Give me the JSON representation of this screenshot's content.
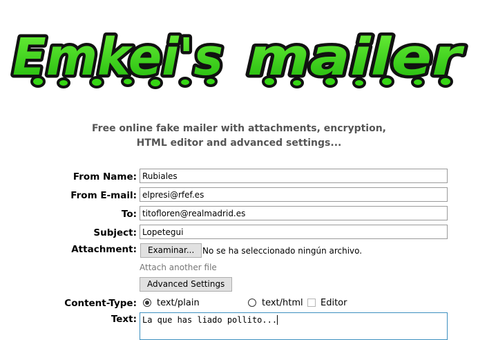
{
  "logo": {
    "word1": "Emkei's",
    "word2": "mailer"
  },
  "tagline": {
    "line1": "Free online fake mailer with attachments, encryption,",
    "line2": "HTML editor and advanced settings..."
  },
  "form": {
    "from_name": {
      "label": "From Name:",
      "value": "Rubiales"
    },
    "from_email": {
      "label": "From E-mail:",
      "value": "elpresi@rfef.es"
    },
    "to": {
      "label": "To:",
      "value": "titofloren@realmadrid.es"
    },
    "subject": {
      "label": "Subject:",
      "value": "Lopetegui"
    },
    "attachment": {
      "label": "Attachment:",
      "browse_label": "Examinar...",
      "status": "No se ha seleccionado ningún archivo.",
      "another_link": "Attach another file"
    },
    "advanced_button": "Advanced Settings",
    "content_type": {
      "label": "Content-Type:",
      "options": [
        {
          "label": "text/plain",
          "selected": true
        },
        {
          "label": "text/html",
          "selected": false
        }
      ],
      "editor_label": "Editor",
      "editor_checked": false
    },
    "text": {
      "label": "Text:",
      "value": "La que has liado pollito..."
    }
  },
  "colors": {
    "logo_fill": "#35d614",
    "logo_outline": "#111111",
    "tagline": "#555555",
    "textarea_focus": "#3c8fbf",
    "button_bg": "#e1e1e1"
  }
}
